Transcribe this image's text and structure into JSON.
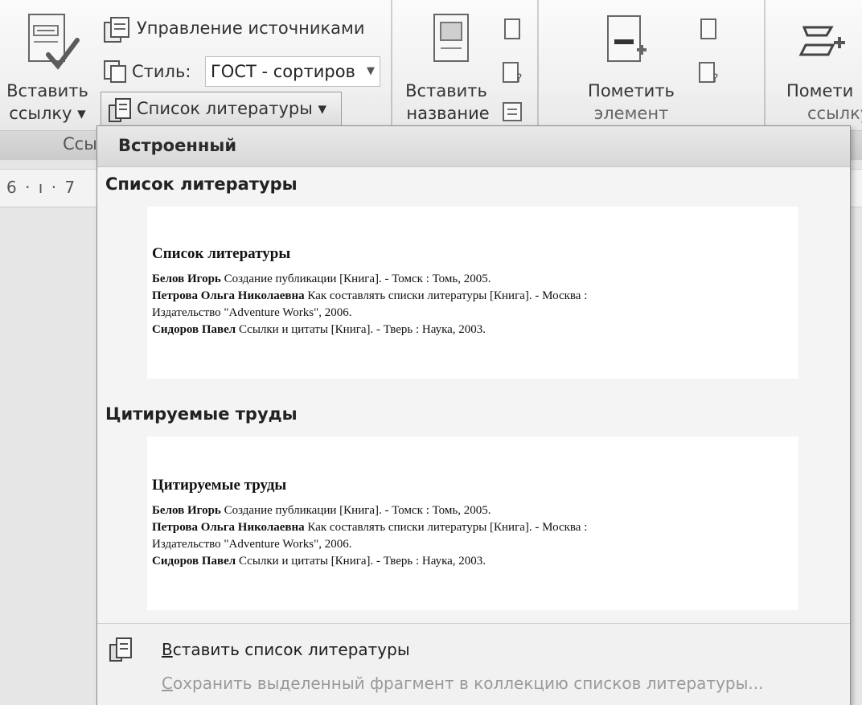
{
  "ribbon": {
    "insert_citation": {
      "line1": "Вставить",
      "line2": "ссылку ▾"
    },
    "manage_sources": "Управление источниками",
    "style_label": "Стиль:",
    "style_value": "ГОСТ - сортиров",
    "bibliography_label": "Список литературы ▾",
    "insert_caption": {
      "line1": "Вставить",
      "line2": "название"
    },
    "mark_entry": {
      "line1": "Пометить",
      "line2": "элемент"
    },
    "mark_citation": {
      "line1": "Помети",
      "line2": "ссылку"
    },
    "group_label_partial": "Ссы"
  },
  "ruler": {
    "text": "6 · ı · 7"
  },
  "dropdown": {
    "header": "Встроенный",
    "sections": [
      {
        "title": "Список литературы",
        "preview_title": "Список литературы",
        "entries": [
          {
            "author": "Белов Игорь",
            "text": " Создание публикации [Книга]. - Томск : Томь, 2005."
          },
          {
            "author": "Петрова Ольга Николаевна",
            "text": " Как составлять списки литературы [Книга]. - Москва :"
          },
          {
            "author": "",
            "text": "Издательство \"Adventure Works\", 2006."
          },
          {
            "author": "Сидоров Павел",
            "text": " Ссылки и цитаты [Книга]. - Тверь : Наука, 2003."
          }
        ]
      },
      {
        "title": "Цитируемые труды",
        "preview_title": "Цитируемые труды",
        "entries": [
          {
            "author": "Белов Игорь",
            "text": " Создание публикации [Книга]. - Томск : Томь, 2005."
          },
          {
            "author": "Петрова Ольга Николаевна",
            "text": " Как составлять списки литературы [Книга]. - Москва :"
          },
          {
            "author": "",
            "text": "Издательство \"Adventure Works\", 2006."
          },
          {
            "author": "Сидоров Павел",
            "text": " Ссылки и цитаты [Книга]. - Тверь : Наука, 2003."
          }
        ]
      }
    ],
    "insert_bibliography": {
      "hotkey": "В",
      "rest": "ставить список литературы"
    },
    "save_selection": {
      "hotkey": "С",
      "rest": "охранить выделенный фрагмент в коллекцию списков литературы..."
    }
  }
}
